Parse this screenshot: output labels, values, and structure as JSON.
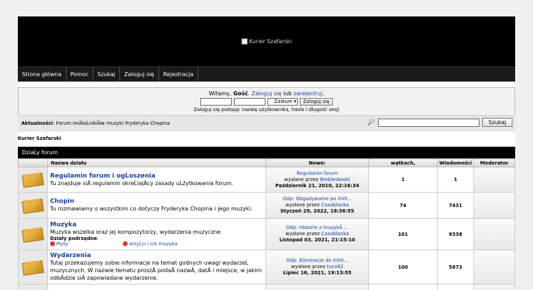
{
  "logo_alt": "Kurier Szafarski",
  "nav": [
    "Strona główna",
    "Pomoc",
    "Szukaj",
    "Zaloguj się",
    "Rejestracja"
  ],
  "login": {
    "welcome_pre": "Witamy, ",
    "guest": "Gość",
    "welcome_login": "Zaloguj się",
    "welcome_or": " lub ",
    "welcome_register": "zarejestruj",
    "duration": "Zawsze",
    "button": "Zaloguj się",
    "hint": "Zaloguj się podając nazwę użytkownika, hasło i długość sesji"
  },
  "news": {
    "label": "Aktualności",
    "text": "Forum miĂłoĹnikĂłw muzyki Fryderyka Chopina"
  },
  "search": {
    "button": "Szukaj"
  },
  "breadcrumb": "Kurier Szafarski",
  "category": "DziaĹy forum",
  "columns": [
    "Nazwa działu",
    "Nowe:",
    "wątkach,",
    "Wiadomości",
    "Moderator"
  ],
  "forums": [
    {
      "title": "Regulamin forum i ogĹoszenia",
      "desc": "Tu znajduje siÄ regulamin okreĹlajÄcy zasady uĹźytkowania forum.",
      "last_title": "Regulamin forum",
      "last_by": "wysłane przez",
      "last_user": "Niebieskooki",
      "last_date": "Październik 21, 2010, 22:16:34",
      "topics": "1",
      "posts": "1"
    },
    {
      "title": "Chopin",
      "desc": "Tu rozmawiamy o wszystkim co dotyczy Fryderyka Chopina i jego muzyki.",
      "last_title": "Odp: Obgadywanie po XVII...",
      "last_by": "wysłane przez",
      "last_user": "Casablanka",
      "last_date": "Styczeń 29, 2022, 18:36:55",
      "topics": "74",
      "posts": "7431"
    },
    {
      "title": "Muzyka",
      "desc": "Muzyka wszelka oraz jej kompozytorzy, wydarzenia muzyczne",
      "sub_label": "Działy podrzędne",
      "subs": [
        "Płyty",
        "ArtyĹci i ich muzyka"
      ],
      "last_title": "Odp: Historie z muzykÄ ...",
      "last_by": "wysłane przez",
      "last_user": "Casablanka",
      "last_date": "Listopad 03, 2021, 21:15:10",
      "topics": "101",
      "posts": "9338"
    },
    {
      "title": "Wydarzenia",
      "desc": "Tutaj przekazujemy sobie informacje na temat godnych uwagi wydarzeĹ muzycznych. W nazwie tematu proszÄ podaÄ nazwÄ, datÄ i miejsce, w jakim odbÄdzie siÄ zapowiadane wydarzenie.",
      "last_title": "Odp: Eliminacje do XVIII...",
      "last_by": "wysłane przez",
      "last_user": "tuco82",
      "last_date": "Lipiec 16, 2021, 19:13:55",
      "topics": "100",
      "posts": "5873"
    }
  ]
}
